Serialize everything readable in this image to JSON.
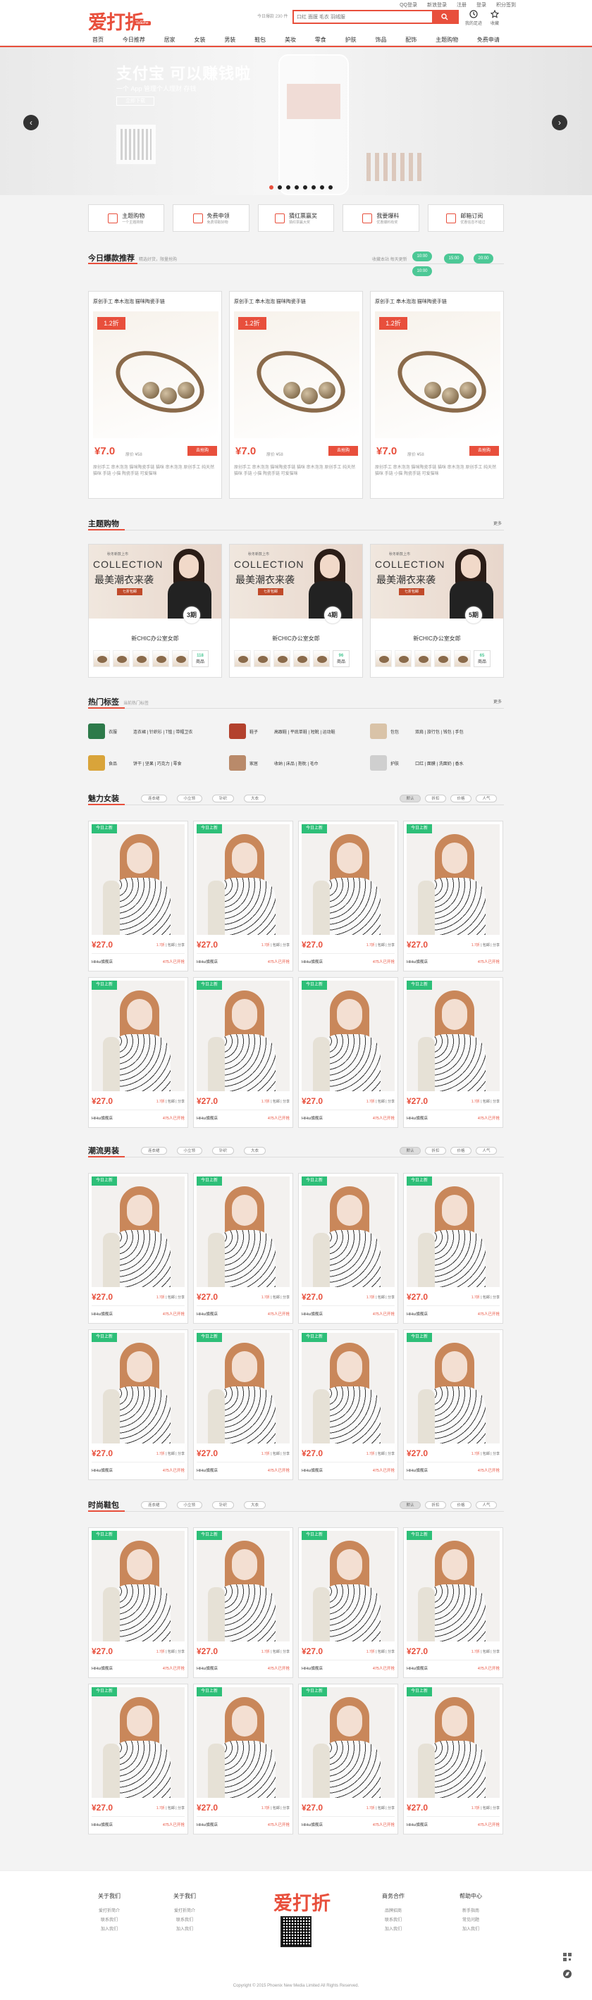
{
  "header": {
    "logo_text": "爱打折",
    "logo_tag": "aidazhe",
    "top_links": [
      "QQ登录",
      "新浪登录",
      "注册",
      "登录",
      "积分签到"
    ],
    "search_placeholder": "口红 面膜 毛衣 羽绒服",
    "hot_note": "今日爆款 230 件",
    "user_icons": [
      {
        "label": "我的足迹",
        "icon": "clock-icon"
      },
      {
        "label": "收藏",
        "icon": "star-icon"
      }
    ]
  },
  "nav": [
    "首页",
    "今日推荐",
    "居家",
    "女装",
    "男装",
    "鞋包",
    "美妆",
    "零食",
    "护肤",
    "饰品",
    "配饰",
    "主题购物",
    "免费申请"
  ],
  "banner": {
    "title": "支付宝 可以赚钱啦",
    "subtitle": "一个 App 管理个人理财 存钱",
    "button": "立即下载",
    "prev": "‹",
    "next": "›",
    "slide_count": 8,
    "active_slide": 0
  },
  "features": [
    {
      "title": "主题购物",
      "sub": "一个主题购物",
      "icon": "shirt-icon"
    },
    {
      "title": "免费申领",
      "sub": "免费领取好物",
      "icon": "gift-icon"
    },
    {
      "title": "猜红票赢奖",
      "sub": "猜红票赢大奖",
      "icon": "ticket-icon"
    },
    {
      "title": "我要爆料",
      "sub": "优惠爆料有奖",
      "icon": "pen-icon"
    },
    {
      "title": "邮箱订阅",
      "sub": "优惠信息不错过",
      "icon": "mail-icon"
    }
  ],
  "hot": {
    "title": "今日爆款推荐",
    "sub": "精选好货，限量抢购",
    "fav_note": "收藏本站 每天更新",
    "bubbles": [
      "10:00",
      "15:00",
      "20:00"
    ],
    "items": [
      {
        "name": "原创手工 串木泡泡 猫咪陶瓷手链",
        "tag": "1.2折",
        "price": "¥7.0",
        "orig": "原价 ¥58",
        "btn": "去抢购",
        "desc": "原创手工 串木泡泡 猫咪陶瓷手链 猫咪 串木泡泡 原创手工 纯天然 猫咪 手链 小猫 陶瓷手链 可爱猫咪"
      },
      {
        "name": "原创手工 串木泡泡 猫咪陶瓷手链",
        "tag": "1.2折",
        "price": "¥7.0",
        "orig": "原价 ¥58",
        "btn": "去抢购",
        "desc": "原创手工 串木泡泡 猫咪陶瓷手链 猫咪 串木泡泡 原创手工 纯天然 猫咪 手链 小猫 陶瓷手链 可爱猫咪"
      },
      {
        "name": "原创手工 串木泡泡 猫咪陶瓷手链",
        "tag": "1.2折",
        "price": "¥7.0",
        "orig": "原价 ¥58",
        "btn": "去抢购",
        "desc": "原创手工 串木泡泡 猫咪陶瓷手链 猫咪 串木泡泡 原创手工 纯天然 猫咪 手链 小猫 陶瓷手链 可爱猫咪"
      }
    ]
  },
  "theme": {
    "title": "主题购物",
    "more": "更多",
    "items": [
      {
        "small": "秋冬新款上市",
        "collection": "COLLECTION",
        "cn": "最美潮衣来袭",
        "pill": "七折包邮",
        "count": "3期",
        "name": "新CHIC办公室女郎",
        "total": "118",
        "unit": "商品"
      },
      {
        "small": "秋冬新款上市",
        "collection": "COLLECTION",
        "cn": "最美潮衣来袭",
        "pill": "七折包邮",
        "count": "4期",
        "name": "新CHIC办公室女郎",
        "total": "96",
        "unit": "商品"
      },
      {
        "small": "秋冬新款上市",
        "collection": "COLLECTION",
        "cn": "最美潮衣来袭",
        "pill": "七折包邮",
        "count": "5期",
        "name": "新CHIC办公室女郎",
        "total": "65",
        "unit": "商品"
      }
    ]
  },
  "tags": {
    "title": "热门标签",
    "sub": "当前热门标签",
    "more": "更多",
    "row1": [
      {
        "cat": "衣服",
        "words": "连衣裙 | 针织衫 | T恤 | 带帽卫衣",
        "color": "#2d7a4a"
      },
      {
        "cat": "鞋子",
        "words": "高跟鞋 | 平底单鞋 | 短靴 | 运动鞋",
        "color": "#b3412d"
      },
      {
        "cat": "包包",
        "words": "双肩 | 旅行包 | 钱包 | 手包",
        "color": "#d9c3a8"
      }
    ],
    "row2": [
      {
        "cat": "食品",
        "words": "饼干 | 坚果 | 巧克力 | 零食",
        "color": "#d9a43a"
      },
      {
        "cat": "家居",
        "words": "收纳 | 床品 | 抱枕 | 毛巾",
        "color": "#b98a6a"
      },
      {
        "cat": "护肤",
        "words": "口红 | 面膜 | 洗面奶 | 香水",
        "color": "#cfcfcf"
      }
    ]
  },
  "sections": [
    {
      "title": "魅力女装",
      "filters": [
        "连衣裙",
        "小立领",
        "针织",
        "大衣"
      ],
      "sorts": [
        "默认",
        "折扣",
        "价格",
        "人气"
      ],
      "rows": 2
    },
    {
      "title": "潮流男装",
      "filters": [
        "连衣裙",
        "小立领",
        "针织",
        "大衣"
      ],
      "sorts": [
        "默认",
        "折扣",
        "价格",
        "人气"
      ],
      "rows": 2
    },
    {
      "title": "时尚鞋包",
      "filters": [
        "连衣裙",
        "小立领",
        "针织",
        "大衣"
      ],
      "sorts": [
        "默认",
        "折扣",
        "价格",
        "人气"
      ],
      "rows": 2
    }
  ],
  "product": {
    "new": "今日上新",
    "price": "¥27.0",
    "stats_left": "1.7折",
    "stats_mid": "包邮",
    "stats_right": "分享",
    "shop": "HiHui旗舰店",
    "join": "475人已开抢"
  },
  "footer": {
    "cols": [
      {
        "title": "关于我们",
        "items": [
          "爱打折简介",
          "联系我们",
          "加入我们"
        ]
      },
      {
        "title": "关于我们",
        "items": [
          "爱打折简介",
          "联系我们",
          "加入我们"
        ]
      },
      {
        "title": "商务合作",
        "items": [
          "品牌招商",
          "联系我们",
          "加入我们"
        ]
      },
      {
        "title": "帮助中心",
        "items": [
          "新手指南",
          "常见问题",
          "加入我们"
        ]
      }
    ],
    "logo": "爱打折",
    "copyright": "Copyright © 2015 Phoenix New Media Limited All Rights Reserved."
  },
  "colors": {
    "brand": "#e84f3c",
    "green": "#2dbf78"
  }
}
